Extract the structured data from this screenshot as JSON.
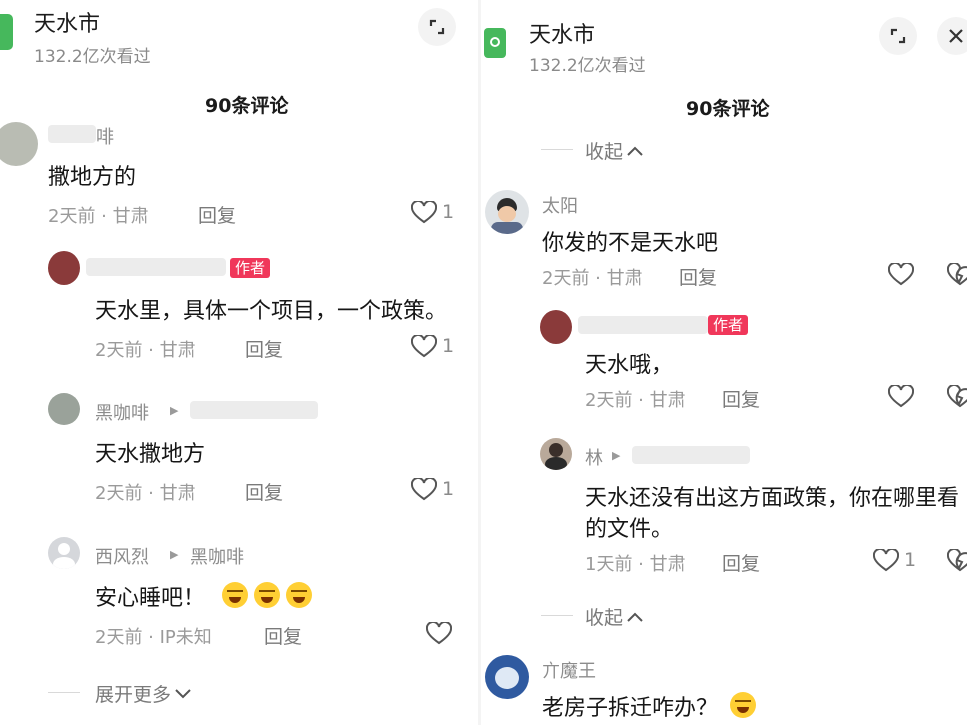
{
  "left": {
    "header": {
      "title": "天水市",
      "views": "132.2亿次看过"
    },
    "comment_count": "90条评论",
    "comments": [
      {
        "name": "啡",
        "text": "撒地方的",
        "meta": "2天前 · 甘肃",
        "reply": "回复",
        "likes": "1"
      },
      {
        "badge": "作者",
        "text": "天水里，具体一个项目，一个政策。",
        "meta": "2天前 · 甘肃",
        "reply": "回复",
        "likes": "1"
      },
      {
        "name": "黑咖啡",
        "text": "天水撒地方",
        "meta": "2天前 · 甘肃",
        "reply": "回复",
        "likes": "1"
      },
      {
        "name": "西风烈",
        "reply_to": "黑咖啡",
        "text": "安心睡吧！",
        "meta": "2天前 · IP未知",
        "reply": "回复",
        "likes": ""
      }
    ],
    "expand_more": "展开更多"
  },
  "right": {
    "header": {
      "title": "天水市",
      "views": "132.2亿次看过"
    },
    "comment_count": "90条评论",
    "collapse_top": "收起",
    "comments": [
      {
        "name": "太阳",
        "text": "你发的不是天水吧",
        "meta": "2天前 · 甘肃",
        "reply": "回复",
        "likes": ""
      },
      {
        "badge": "作者",
        "text": "天水哦，",
        "meta": "2天前 · 甘肃",
        "reply": "回复",
        "likes": ""
      },
      {
        "name": "林",
        "text_line1": "天水还没有出这方面政策，你在哪里看",
        "text_line2": "的文件。",
        "meta": "1天前 · 甘肃",
        "reply": "回复",
        "likes": "1"
      },
      {
        "name": "亣魔王",
        "text": "老房子拆迁咋办？"
      }
    ],
    "collapse_bottom": "收起"
  },
  "colors": {
    "brand_green": "#46b85c",
    "author_badge": "#f0375a",
    "meta_gray": "#9a9a9a"
  },
  "icons": [
    "app-icon",
    "fullscreen-icon",
    "close-icon",
    "heart-icon",
    "chevron-up-icon",
    "chevron-down-icon",
    "laugh-cry-emoji",
    "thinking-emoji"
  ]
}
